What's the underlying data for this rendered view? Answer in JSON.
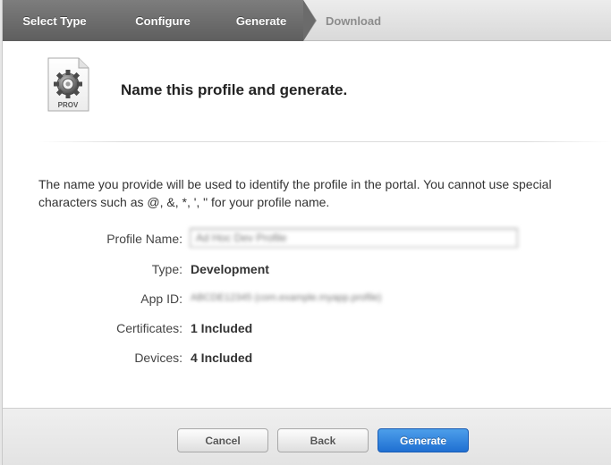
{
  "steps": [
    {
      "label": "Select Type",
      "state": "done"
    },
    {
      "label": "Configure",
      "state": "done"
    },
    {
      "label": "Generate",
      "state": "done"
    },
    {
      "label": "Download",
      "state": "pending"
    }
  ],
  "header": {
    "icon_label": "PROV",
    "title": "Name this profile and generate."
  },
  "description": "The name you provide will be used to identify the profile in the portal. You cannot use special characters such as @, &, *, ', \" for your profile name.",
  "form": {
    "profile_name_label": "Profile Name:",
    "profile_name_value": "Ad Hoc Dev Profile",
    "type_label": "Type:",
    "type_value": "Development",
    "app_id_label": "App ID:",
    "app_id_value": "ABCDE12345 (com.example.myapp.profile)",
    "certificates_label": "Certificates:",
    "certificates_value": "1 Included",
    "devices_label": "Devices:",
    "devices_value": "4 Included"
  },
  "footer": {
    "cancel_label": "Cancel",
    "back_label": "Back",
    "generate_label": "Generate"
  },
  "colors": {
    "accent": "#2a7ee0",
    "step_done": "#6b6b6b"
  }
}
